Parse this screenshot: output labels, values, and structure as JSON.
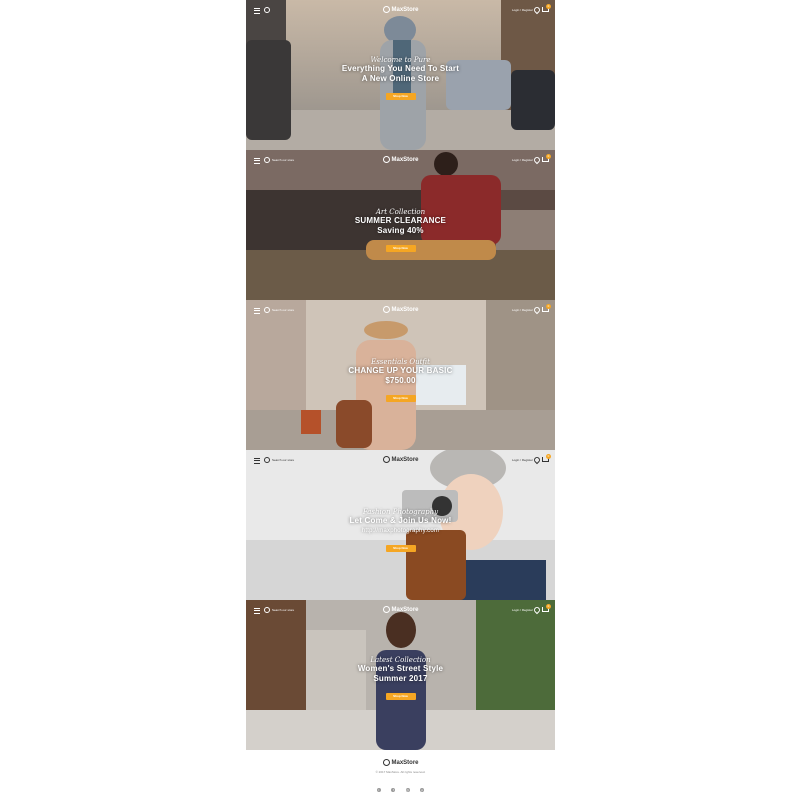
{
  "brand": {
    "name": "MaxStore"
  },
  "header": {
    "search_placeholder": "Search our store",
    "account_label": "Login / Register",
    "cart_count": "0"
  },
  "slides": [
    {
      "script": "Welcome to Pure",
      "lines": [
        "Everything You Need To Start",
        "A New Online Store"
      ],
      "button": "Shop Now"
    },
    {
      "script": "Art Collection",
      "lines": [
        "SUMMER CLEARANCE",
        "Saving 40%"
      ],
      "button": "Shop Now"
    },
    {
      "script": "Essentials Outfit",
      "lines": [
        "CHANGE UP YOUR BASIC",
        "$750.00"
      ],
      "button": "Shop Now"
    },
    {
      "script": "Fashion Photography",
      "lines": [
        "Let Come & Join Us Now!",
        "http://maxphotography.com"
      ],
      "button": "Shop Now"
    },
    {
      "script": "Latest Collection",
      "lines": [
        "Women's Street Style",
        "Summer 2017"
      ],
      "button": "Shop Now"
    }
  ],
  "footer": {
    "copyright": "© 2017 MaxStore. All rights reserved.",
    "social": [
      "twitter-icon",
      "facebook-icon",
      "instagram-icon",
      "pinterest-icon"
    ]
  },
  "colors": {
    "accent": "#f5a623"
  }
}
